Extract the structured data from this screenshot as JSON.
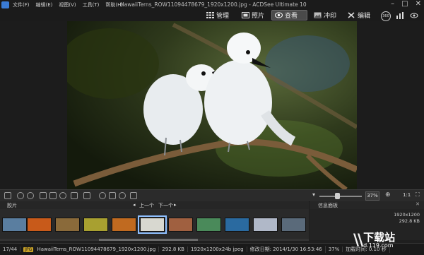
{
  "titlebar": {
    "menus": [
      "文件(F)",
      "编辑(E)",
      "视图(V)",
      "工具(T)",
      "帮助(H)"
    ],
    "window_title": "HawaiiTerns_ROW11094478679_1920x1200.jpg - ACDSee Ultimate 10",
    "controls": [
      "–",
      "□",
      "✕"
    ]
  },
  "modes": [
    {
      "label": "管理",
      "icon": "grid-icon"
    },
    {
      "label": "照片",
      "icon": "photo-icon"
    },
    {
      "label": "查看",
      "icon": "eye-icon",
      "active": true
    },
    {
      "label": "冲印",
      "icon": "develop-icon"
    },
    {
      "label": "编辑",
      "icon": "edit-icon"
    }
  ],
  "right_icons": [
    "360-icon",
    "stats-icon",
    "eye-settings-icon"
  ],
  "toolbar": {
    "zoom": "37%",
    "ratio": "1:1"
  },
  "filmstrip": {
    "title": "胶片",
    "prev_label": "上一个",
    "next_label": "下一个",
    "thumb_colors": [
      "#5a7ea0",
      "#c85a1a",
      "#8a6a3a",
      "#a8a030",
      "#c06a20",
      "#d8d8d0",
      "#a06040",
      "#4a8a5a",
      "#2a6aa0",
      "#b0b8c8",
      "#5a6a7a"
    ]
  },
  "info_panel": {
    "title": "信息面板",
    "lines": [
      "1920x1200",
      "292.8 KB"
    ]
  },
  "status": {
    "index": "17/44",
    "type": "JPG",
    "filename": "HawaiiTerns_ROW11094478679_1920x1200.jpg",
    "size": "292.8 KB",
    "dimensions": "1920x1200x24b jpeg",
    "modified": "修改日期: 2014/1/30 16:53:46",
    "zoom": "37%",
    "load_time": "加载时间: 0.10 秒"
  },
  "watermark": {
    "cn": "下载站",
    "en": "d.119.com"
  },
  "colors": {
    "accent": "#8fc0ff",
    "badge": "#c9a227"
  }
}
